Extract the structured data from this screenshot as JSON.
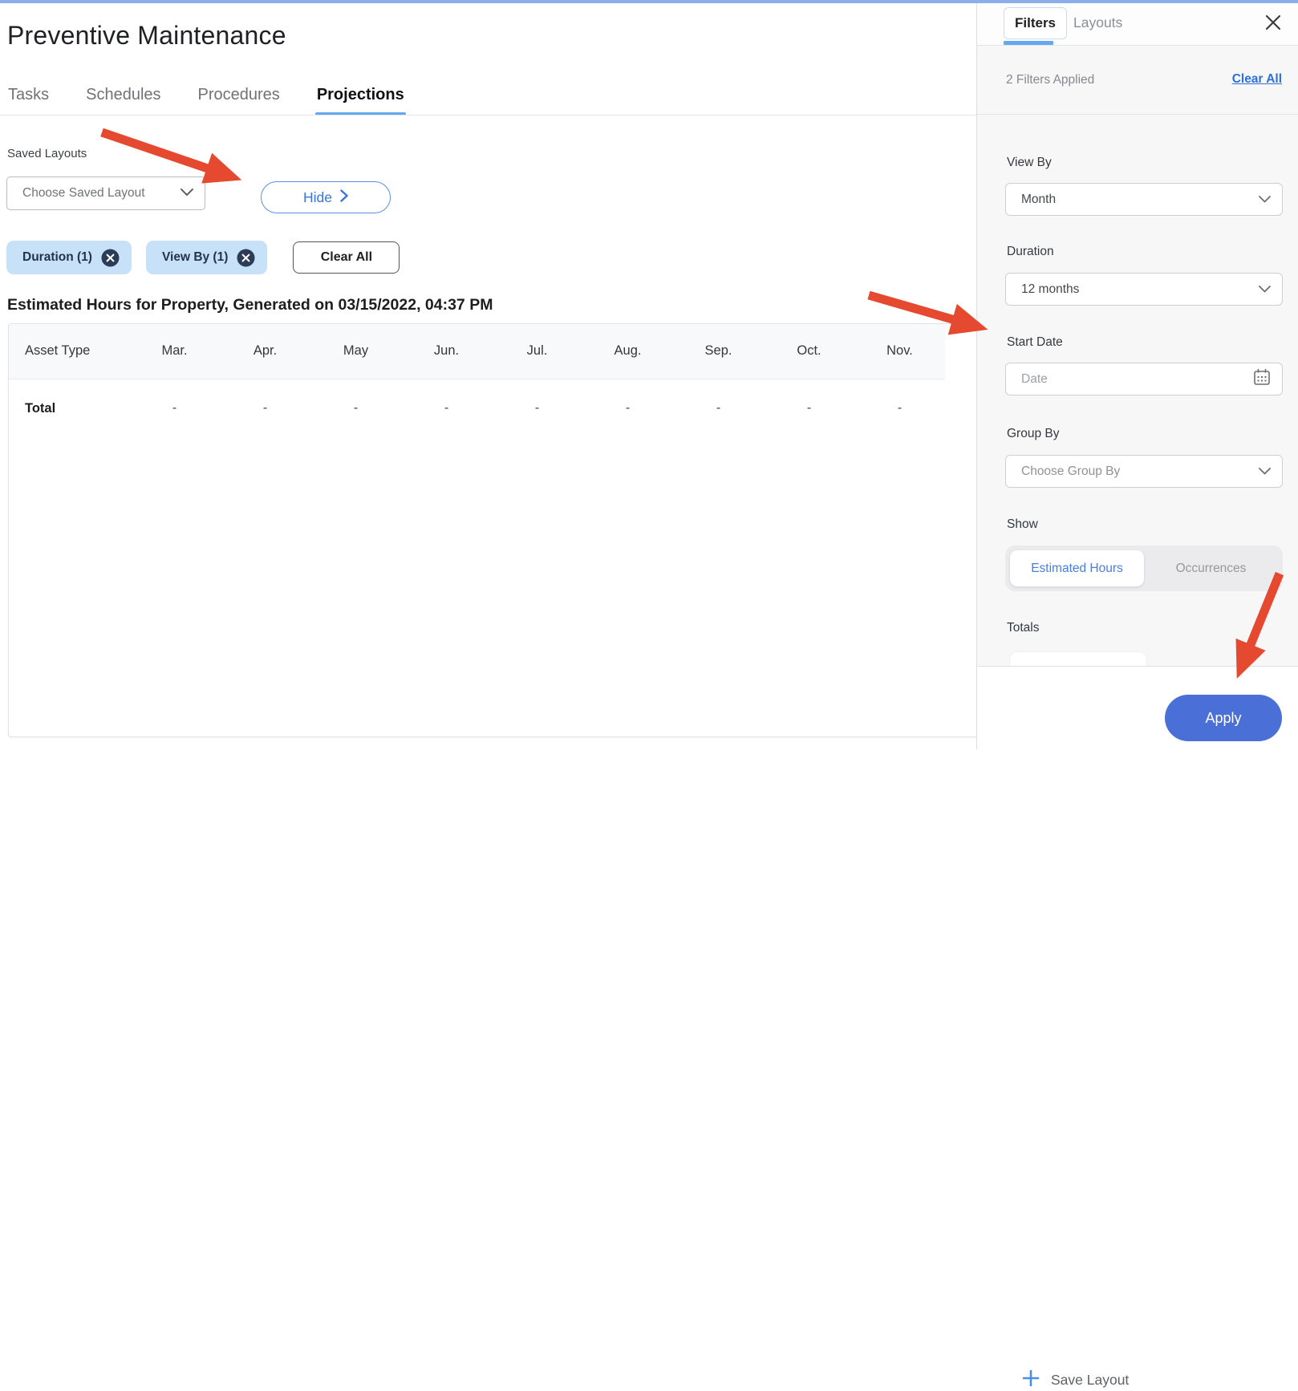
{
  "page": {
    "title": "Preventive Maintenance"
  },
  "tabs": [
    {
      "label": "Tasks",
      "active": false
    },
    {
      "label": "Schedules",
      "active": false
    },
    {
      "label": "Procedures",
      "active": false
    },
    {
      "label": "Projections",
      "active": true
    }
  ],
  "toolbar": {
    "saved_layouts_label": "Saved Layouts",
    "saved_layout_placeholder": "Choose Saved Layout",
    "hide_button": "Hide",
    "clear_all_button": "Clear All"
  },
  "filter_chips": [
    {
      "label": "Duration (1)"
    },
    {
      "label": "View By (1)"
    }
  ],
  "table": {
    "title": "Estimated Hours for Property, Generated on 03/15/2022, 04:37 PM",
    "columns": [
      "Asset Type",
      "Mar.",
      "Apr.",
      "May",
      "Jun.",
      "Jul.",
      "Aug.",
      "Sep.",
      "Oct.",
      "Nov."
    ],
    "rows": [
      {
        "label": "Total",
        "values": [
          "-",
          "-",
          "-",
          "-",
          "-",
          "-",
          "-",
          "-",
          "-"
        ]
      }
    ]
  },
  "filters_panel": {
    "tabs": [
      {
        "label": "Filters",
        "active": true
      },
      {
        "label": "Layouts",
        "active": false
      }
    ],
    "applied_text": "2 Filters Applied",
    "clear_all_link": "Clear All",
    "fields": [
      {
        "label": "View By",
        "value": "Month"
      },
      {
        "label": "Duration",
        "value": "12 months"
      },
      {
        "label": "Start Date",
        "placeholder": "Date"
      },
      {
        "label": "Group By",
        "placeholder": "Choose Group By"
      }
    ],
    "show": {
      "label": "Show",
      "options": [
        {
          "label": "Estimated Hours",
          "selected": true
        },
        {
          "label": "Occurrences",
          "selected": false
        }
      ]
    },
    "totals_label": "Totals",
    "footer": {
      "save_layout_button": "Save Layout",
      "apply_button": "Apply"
    }
  },
  "colors": {
    "accent_blue": "#4a6fd6",
    "tab_underline_blue": "#64a8f0",
    "chip_bg": "#c7e2f8",
    "chip_text": "#24334d",
    "arrow_red": "#e5492f",
    "link_blue": "#2e6fd8"
  }
}
